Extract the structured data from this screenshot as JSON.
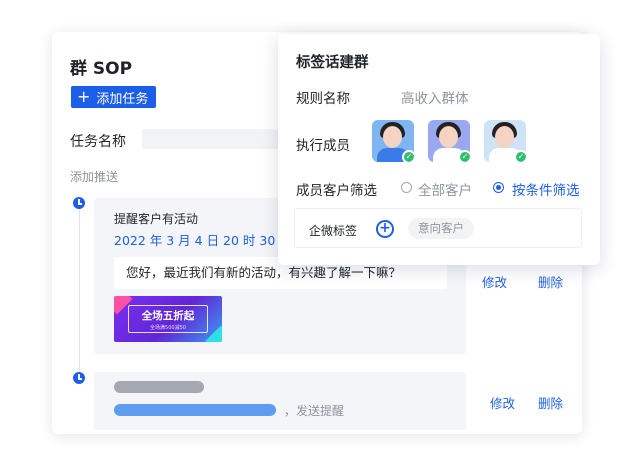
{
  "main": {
    "title": "群 SOP",
    "add_task_label": "添加任务",
    "task_name_label": "任务名称",
    "add_push_label": "添加推送",
    "push_item": {
      "title": "提醒客户有活动",
      "time": "2022 年 3 月 4 日 20 时 30 分",
      "message": "您好，最近我们有新的活动，有兴趣了解一下嘛？",
      "banner_text": "全场五折起",
      "banner_sub": "全场满500减50"
    },
    "edit_label": "修改",
    "delete_label": "删除",
    "push_item_2": {
      "suffix": "，发送提醒"
    }
  },
  "popup": {
    "title": "标签话建群",
    "rule_name_label": "规则名称",
    "rule_name_value": "高收入群体",
    "members_label": "执行成员",
    "members": [
      {
        "icon": "avatar-1",
        "shirt": "#3b7be8",
        "bg": "#7fb6f2"
      },
      {
        "icon": "avatar-2",
        "shirt": "#ffffff",
        "bg": "#9aa8f0"
      },
      {
        "icon": "avatar-3",
        "shirt": "#ffffff",
        "bg": "#cfe3f7"
      }
    ],
    "filter_label": "成员客户筛选",
    "option_all": "全部客户",
    "option_condition": "按条件筛选",
    "tag_label": "企微标签",
    "tag_chip": "意向客户"
  },
  "colors": {
    "accent": "#1d5ee8",
    "check": "#2fbf71"
  }
}
